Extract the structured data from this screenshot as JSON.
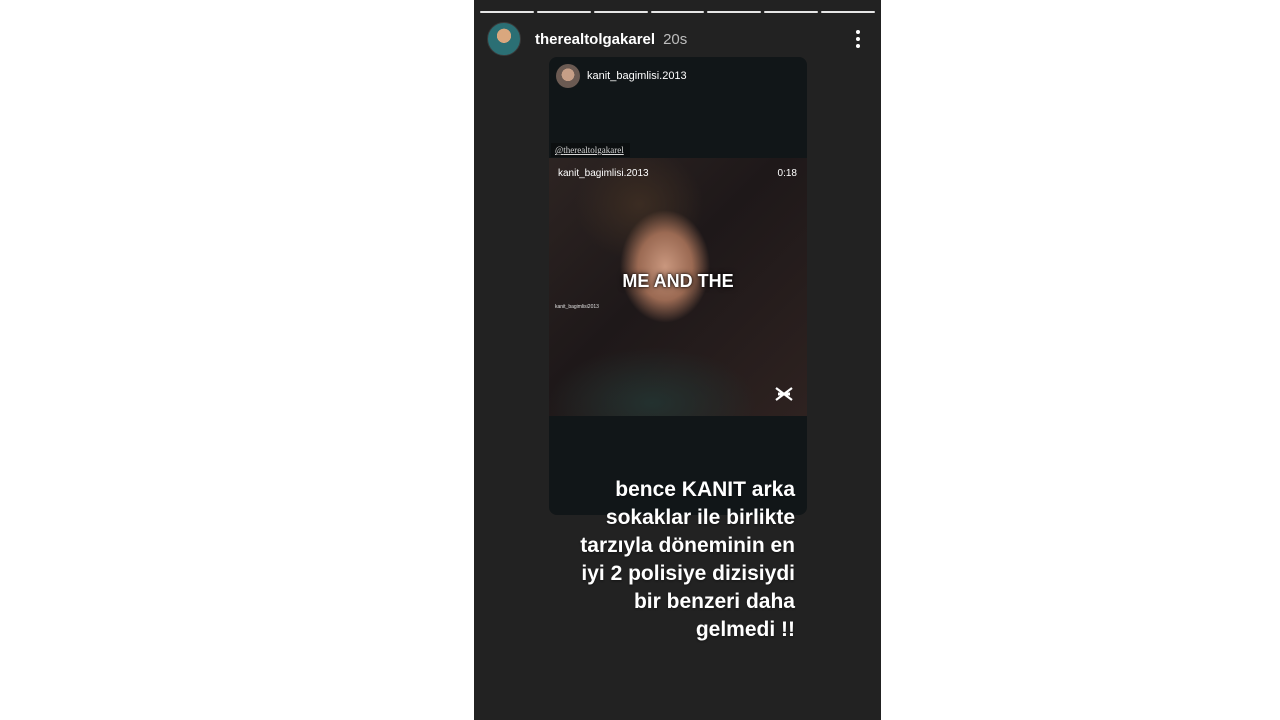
{
  "story": {
    "progress_segments": [
      {
        "state": "done"
      },
      {
        "state": "done"
      },
      {
        "state": "done"
      },
      {
        "state": "done"
      },
      {
        "state": "done"
      },
      {
        "state": "done"
      },
      {
        "state": "done"
      }
    ],
    "username": "therealtolgakarel",
    "time": "20s",
    "menu_icon": "more-vertical-icon"
  },
  "shared_post": {
    "username": "kanit_bagimlisi.2013",
    "mention_prefix": "@",
    "mention_user": "therealtolgakarel",
    "video": {
      "username": "kanit_bagimlisi.2013",
      "duration": "0:18",
      "overlay_text": "ME AND THE",
      "watermark": "kanit_bagimlisi2013",
      "editor_icon": "capcut-icon"
    }
  },
  "caption_lines": [
    "bence KANIT arka",
    "sokaklar ile birlikte",
    "tarzıyla döneminin en",
    "iyi 2 polisiye dizisiydi",
    "bir benzeri daha",
    "gelmedi !!"
  ]
}
